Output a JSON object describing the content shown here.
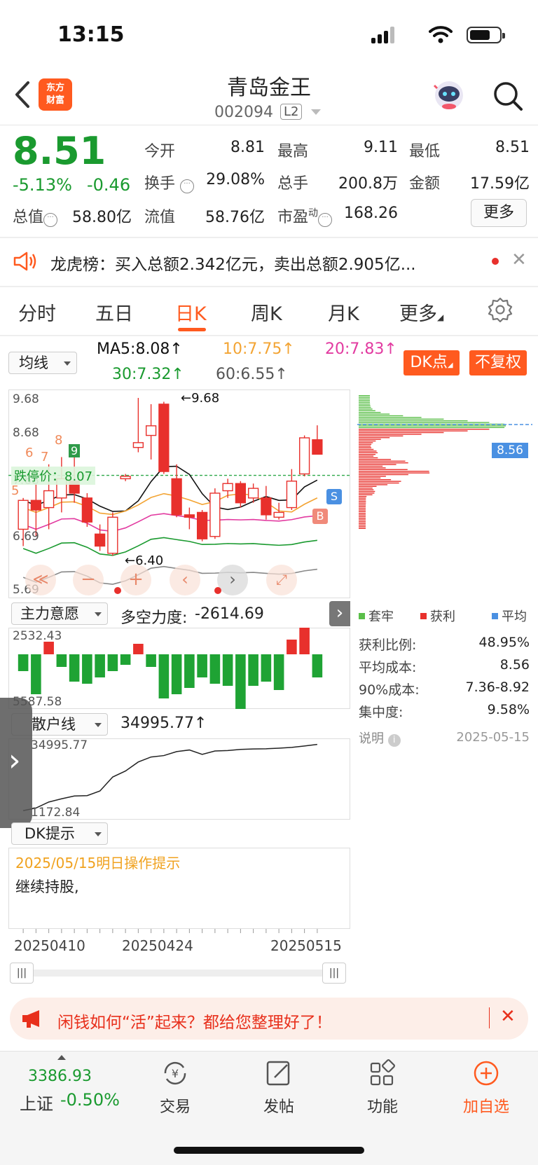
{
  "status": {
    "time": "13:15"
  },
  "header": {
    "back_icon": "chevron-left-icon",
    "logo_line1": "东方",
    "logo_line2": "财富",
    "stock_name": "青岛金王",
    "stock_code": "002094",
    "level_badge": "L2",
    "search_icon": "search-icon"
  },
  "quote": {
    "price": "8.51",
    "pct": "-5.13%",
    "change": "-0.46",
    "open_label": "今开",
    "open": "8.81",
    "high_label": "最高",
    "high": "9.11",
    "low_label": "最低",
    "low": "8.51",
    "turnover_label": "换手",
    "turnover": "29.08%",
    "volume_label": "总手",
    "volume": "200.8万",
    "amount_label": "金额",
    "amount": "17.59亿",
    "mktcap_label": "总值",
    "mktcap": "58.80亿",
    "float_label": "流值",
    "float": "58.76亿",
    "pe_label": "市盈",
    "pe_sup": "动",
    "pe": "168.26",
    "more_label": "更多",
    "colors": {
      "up": "#e8302c",
      "down": "#1a9a2f"
    }
  },
  "lhb": {
    "text": "龙虎榜：买入总额2.342亿元，卖出总额2.905亿...",
    "close": "✕"
  },
  "tabs": [
    "分时",
    "五日",
    "日K",
    "周K",
    "月K",
    "更多"
  ],
  "active_tab": "日K",
  "ma": {
    "selector": "均线",
    "ma5": "MA5:8.08↑",
    "ma10": "10:7.75↑",
    "ma20": "20:7.83↑",
    "ma30": "30:7.32↑",
    "ma60": "60:6.55↑",
    "dk_button": "DK点",
    "fuquan_button": "不复权"
  },
  "kline": {
    "y_labels": [
      "9.68",
      "8.68",
      "7.68",
      "6.69",
      "5.69"
    ],
    "high_mark": "9.68",
    "low_mark": "6.40",
    "limit_label": "跌停价：8.07",
    "current_price_tag": "8.56",
    "signal_s": "S",
    "signal_b": "B",
    "step_numbers": [
      "6",
      "7",
      "8",
      "9",
      "5"
    ]
  },
  "chart_data": {
    "type": "candlestick",
    "bars": 24,
    "candles": [
      {
        "o": 6.95,
        "c": 7.55,
        "h": 7.6,
        "l": 6.6
      },
      {
        "o": 7.55,
        "c": 7.35,
        "h": 7.9,
        "l": 6.8
      },
      {
        "o": 7.4,
        "c": 7.75,
        "h": 8.3,
        "l": 6.95
      },
      {
        "o": 7.6,
        "c": 8.0,
        "h": 8.45,
        "l": 7.3
      },
      {
        "o": 7.95,
        "c": 7.7,
        "h": 8.45,
        "l": 7.5
      },
      {
        "o": 7.6,
        "c": 7.1,
        "h": 7.7,
        "l": 7.0
      },
      {
        "o": 6.85,
        "c": 6.6,
        "h": 7.05,
        "l": 6.5
      },
      {
        "o": 6.45,
        "c": 7.2,
        "h": 7.3,
        "l": 6.4
      },
      {
        "o": 8.0,
        "c": 8.05,
        "h": 8.1,
        "l": 7.95
      },
      {
        "o": 8.65,
        "c": 8.75,
        "h": 9.68,
        "l": 8.55
      },
      {
        "o": 8.9,
        "c": 9.1,
        "h": 9.55,
        "l": 8.4
      },
      {
        "o": 9.55,
        "c": 8.15,
        "h": 9.6,
        "l": 8.1
      },
      {
        "o": 8.0,
        "c": 7.25,
        "h": 8.3,
        "l": 7.2
      },
      {
        "o": 7.25,
        "c": 7.2,
        "h": 7.4,
        "l": 6.95
      },
      {
        "o": 7.3,
        "c": 6.75,
        "h": 7.35,
        "l": 6.7
      },
      {
        "o": 6.8,
        "c": 7.7,
        "h": 7.8,
        "l": 6.75
      },
      {
        "o": 7.75,
        "c": 7.9,
        "h": 8.0,
        "l": 7.6
      },
      {
        "o": 7.9,
        "c": 7.5,
        "h": 7.95,
        "l": 7.4
      },
      {
        "o": 7.6,
        "c": 7.8,
        "h": 7.9,
        "l": 7.5
      },
      {
        "o": 7.6,
        "c": 7.25,
        "h": 7.85,
        "l": 7.15
      },
      {
        "o": 7.2,
        "c": 7.3,
        "h": 7.5,
        "l": 7.15
      },
      {
        "o": 7.4,
        "c": 7.95,
        "h": 8.2,
        "l": 7.35
      },
      {
        "o": 8.1,
        "c": 8.85,
        "h": 8.9,
        "l": 8.05
      },
      {
        "o": 8.81,
        "c": 8.51,
        "h": 9.11,
        "l": 8.51
      }
    ],
    "ylim": [
      5.69,
      9.68
    ],
    "main_force": [
      -0.8,
      -1.9,
      0.6,
      -0.6,
      -1.3,
      -1.4,
      -1.1,
      -0.8,
      -0.5,
      0.5,
      -0.6,
      -2.1,
      -1.9,
      -1.6,
      -1.1,
      -1.4,
      -1.5,
      -2.6,
      -1.5,
      -1.3,
      -1.7,
      0.7,
      1.6,
      -1.1
    ],
    "retail_line": [
      172,
      300,
      600,
      760,
      900,
      920,
      1150,
      1850,
      2150,
      2600,
      2850,
      2920,
      3120,
      3200,
      2980,
      3150,
      3170,
      3230,
      3250,
      3260,
      3290,
      3330,
      3400,
      3480
    ]
  },
  "chip": {
    "legend_trapped": "套牢",
    "legend_profit": "获利",
    "legend_avg": "平均",
    "profit_ratio_label": "获利比例:",
    "profit_ratio": "48.95%",
    "avg_cost_label": "平均成本:",
    "avg_cost": "8.56",
    "cost90_label": "90%成本:",
    "cost90": "7.36-8.92",
    "concentration_label": "集中度:",
    "concentration": "9.58%",
    "explain_label": "说明",
    "date": "2025-05-15"
  },
  "indicators": {
    "main_force_selector": "主力意愿",
    "bull_bear_label": "多空力度:",
    "bull_bear_value": "-2614.69",
    "main_force_y_top": "2532.43",
    "main_force_y_bottom": "5587.58",
    "retail_selector": "散户线",
    "retail_value": "34995.77↑",
    "retail_y_top": "34995.77",
    "retail_y_bottom": "1172.84",
    "dk_selector": "DK提示",
    "dk_date": "2025/05/15明日操作提示",
    "dk_msg": "继续持股,"
  },
  "x_dates": [
    "20250410",
    "20250424",
    "20250515"
  ],
  "promo": {
    "text": "闲钱如何“活”起来？都给您整理好了！",
    "close": "✕"
  },
  "nav": {
    "index_value": "3386.93",
    "index_name": "上证",
    "index_change": "-0.50%",
    "trade": "交易",
    "post": "发帖",
    "func": "功能",
    "add": "加自选"
  }
}
